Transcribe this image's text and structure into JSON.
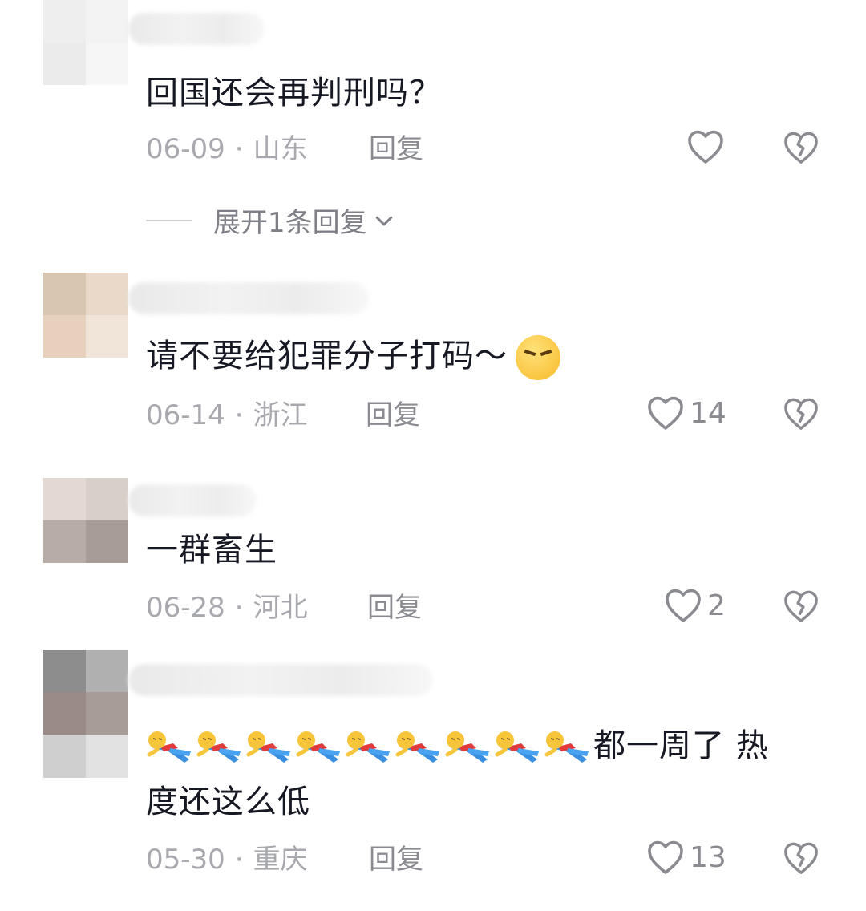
{
  "comments": [
    {
      "text": "回国还会再判刑吗？",
      "date": "06-09",
      "location": "山东",
      "reply_label": "回复",
      "likes": "",
      "expand_label": "展开1条回复"
    },
    {
      "text": "请不要给犯罪分子打码～",
      "date": "06-14",
      "location": "浙江",
      "reply_label": "回复",
      "likes": "14"
    },
    {
      "text": "一群畜生",
      "date": "06-28",
      "location": "河北",
      "reply_label": "回复",
      "likes": "2"
    },
    {
      "text_line1": "都一周了 热",
      "text_line2": "度还这么低",
      "date": "05-30",
      "location": "重庆",
      "reply_label": "回复",
      "likes": "13"
    }
  ],
  "meta_separator": "·",
  "colors": {
    "text": "#161823",
    "meta": "#a8a9ae",
    "icon_stroke": "#8a8b91"
  },
  "icons": {
    "like": "heart-outline-icon",
    "dislike": "broken-heart-icon",
    "expand": "chevron-down-icon"
  }
}
